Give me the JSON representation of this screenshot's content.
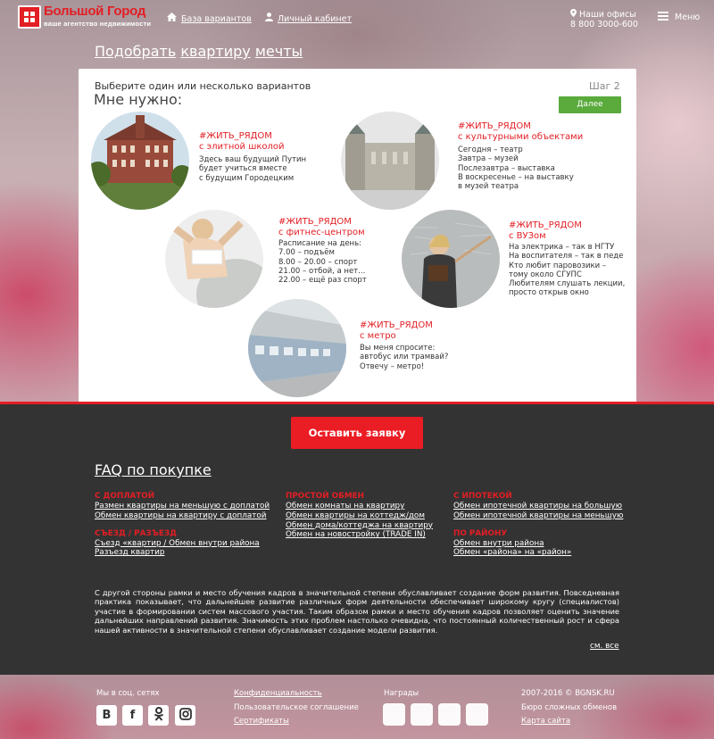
{
  "colors": {
    "brand_red": "#e31e24",
    "green": "#5aaa3c",
    "dark": "#333333"
  },
  "header": {
    "logo_title": "Большой Город",
    "logo_subtitle": "ваше агентство недвижимости",
    "nav_base": "База вариантов",
    "nav_cabinet": "Личный кабинет",
    "offices_label": "Наши офисы",
    "phone": "8 800 3000-600",
    "menu": "Меню"
  },
  "title": {
    "part1": "Подобрать",
    "part2": "квартиру",
    "part3": "мечты"
  },
  "card": {
    "lead": "Выберите один или несколько вариантов",
    "heading": "Мне нужно:",
    "step": "Шаг 2",
    "next": "Далее"
  },
  "options": [
    {
      "tag": "#ЖИТЬ_РЯДОМ",
      "subtitle": "с элитной школой",
      "desc": "Здесь ваш будущий Путин\nбудет учиться вместе\nс будущим Городецким"
    },
    {
      "tag": "#ЖИТЬ_РЯДОМ",
      "subtitle": "с культурными объектами",
      "desc": "Сегодня – театр\nЗавтра – музей\nПослезавтра – выставка\nВ воскресенье – на выставку\nв музей театра"
    },
    {
      "tag": "#ЖИТЬ_РЯДОМ",
      "subtitle": "с фитнес-центром",
      "desc": "Расписание на день:\n7.00 – подъём\n8.00 – 20.00 – спорт\n21.00 – отбой, а нет...\n22.00 – ещё раз спорт"
    },
    {
      "tag": "#ЖИТЬ_РЯДОМ",
      "subtitle": "с ВУЗом",
      "desc": "На электрика – так в НГТУ\nНа воспитателя – так в педе\nКто любит паровозики –\nтому около СГУПС\nЛюбителям слушать лекции,\nпросто открыв окно"
    },
    {
      "tag": "#ЖИТЬ_РЯДОМ",
      "subtitle": "с метро",
      "desc": "Вы меня спросите:\nавтобус или трамвай?\nОтвечу – метро!"
    }
  ],
  "cta": "Оставить заявку",
  "faq": {
    "title": "FAQ по покупке",
    "col1": {
      "head1": "С ДОПЛАТОЙ",
      "links1": [
        "Размен квартиры на меньшую с доплатой",
        "Обмен квартиры на квартиру с доплатой"
      ],
      "head2": "СЪЕЗД / РАЗЪЕЗД",
      "links2": [
        "Съезд «квартир / Обмен внутри района",
        "Разъезд квартир"
      ]
    },
    "col2": {
      "head1": "ПРОСТОЙ ОБМЕН",
      "links1": [
        "Обмен комнаты на квартиру",
        "Обмен квартиры на коттедж/дом",
        "Обмен дома/коттеджа на квартиру",
        "Обмен на новостройку (TRADE IN)"
      ]
    },
    "col3": {
      "head1": "С ИПОТЕКОЙ",
      "links1": [
        "Обмен ипотечной квартиры на большую",
        "Обмен ипотечной квартиры на меньшую"
      ],
      "head2": "ПО РАЙОНУ",
      "links2": [
        "Обмен внутри района",
        "Обмен «района» на «район»"
      ]
    },
    "text": "С другой стороны рамки и место обучения кадров в значительной степени обуславливает создание форм развития. Повседневная практика показывает, что дальнейшее развитие различных форм деятельности обеспечивает широкому кругу (специалистов) участие в формировании систем массового участия. Таким образом рамки и место обучения кадров позволяет оценить значение дальнейших направлений развития. Значимость этих проблем настолько очевидна, что постоянный количественный рост и сфера нашей активности в значительной степени обуславливает создание модели развития.",
    "see_all": "см. все"
  },
  "footer": {
    "social_label": "Мы в соц. сетях",
    "social_icons": [
      "В",
      "f",
      "ok",
      "ig"
    ],
    "privacy": "Конфиденциальность",
    "agreement": "Пользовательское соглашение",
    "certificates": "Сертификаты",
    "awards_label": "Награды",
    "copyright": "2007-2016 © BGNSK.RU",
    "bureau": "Бюро сложных обменов",
    "sitemap": "Карта сайта"
  }
}
